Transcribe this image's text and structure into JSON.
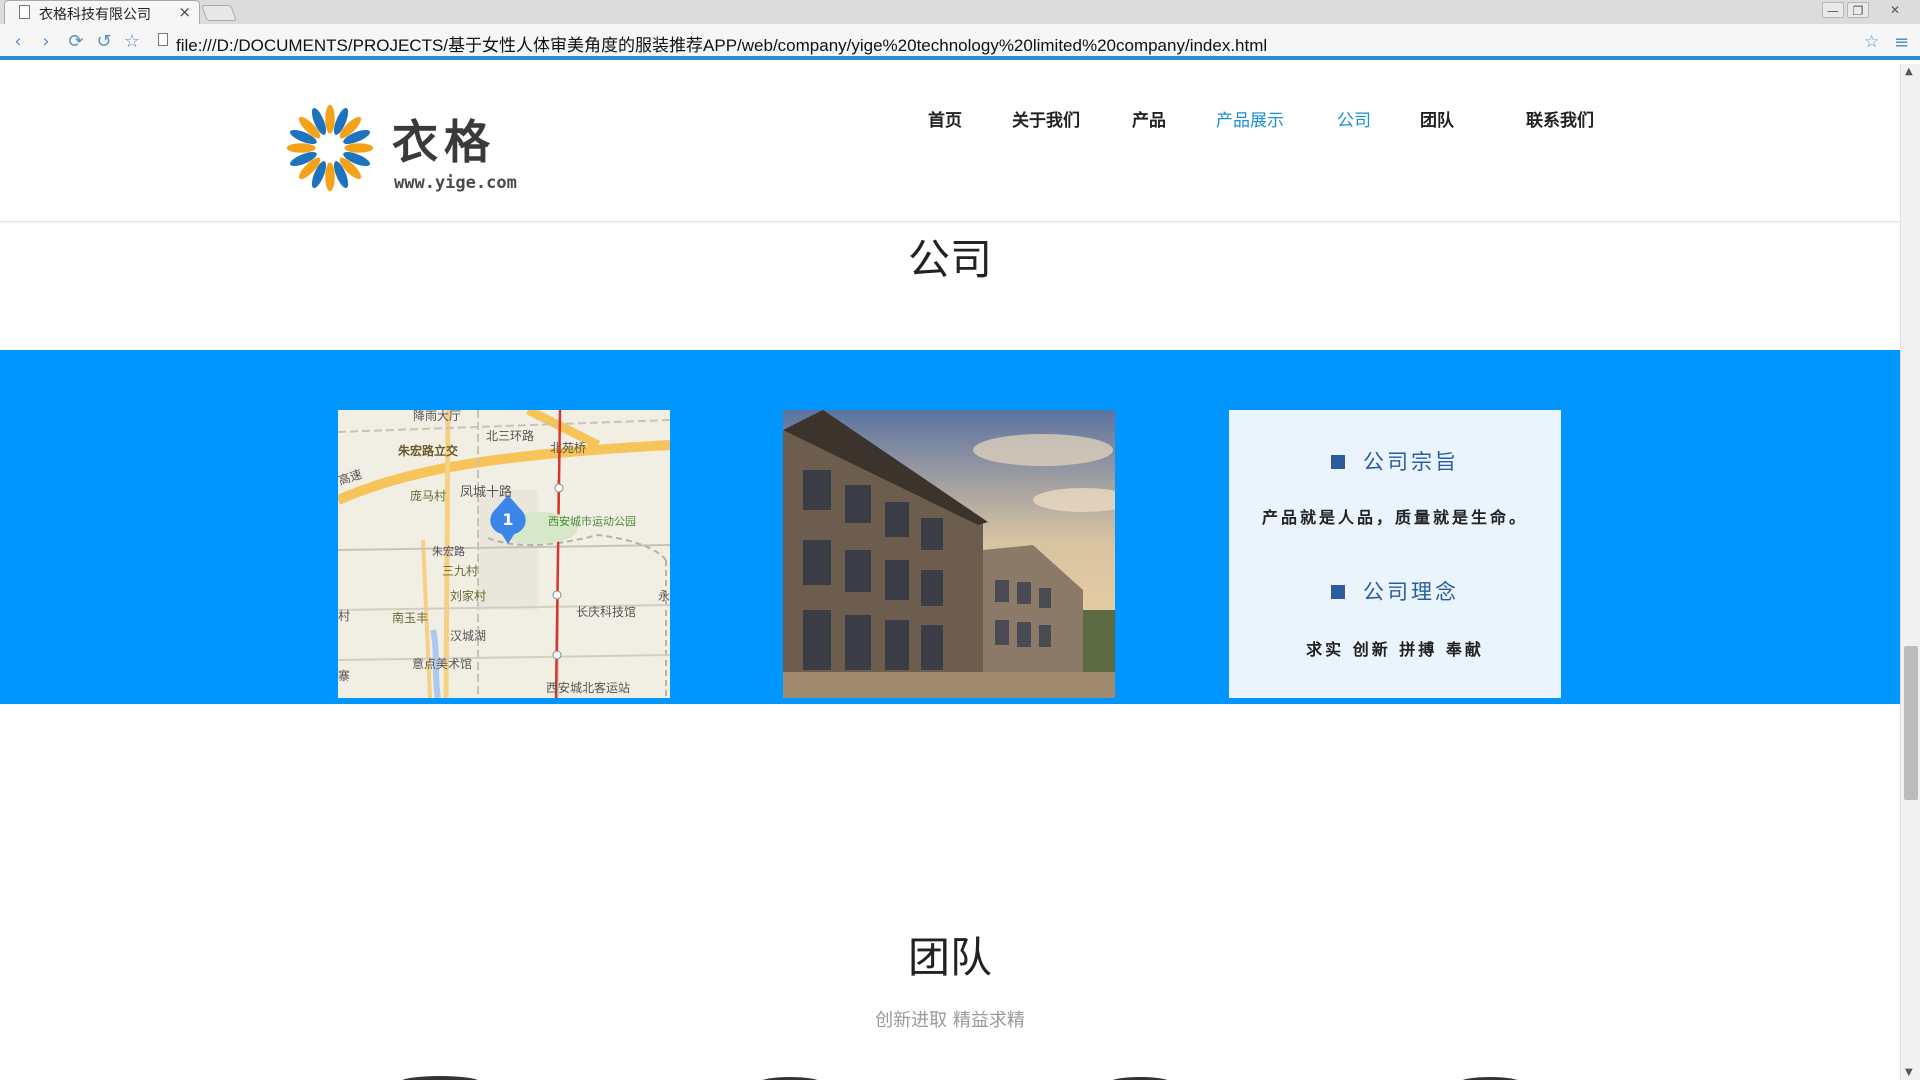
{
  "browser": {
    "tab_title": "衣格科技有限公司",
    "tab_close": "×",
    "url": "file:///D:/DOCUMENTS/PROJECTS/基于女性人体审美角度的服装推荐APP/web/company/yige%20technology%20limited%20company/index.html",
    "window_controls": [
      "—",
      "❐",
      "✕"
    ]
  },
  "header": {
    "logo_name": "衣格",
    "logo_url": "www.yige.com",
    "nav": [
      {
        "label": "首页",
        "active": false
      },
      {
        "label": "关于我们",
        "active": false
      },
      {
        "label": "产品",
        "active": false
      },
      {
        "label": "产品展示",
        "active": true
      },
      {
        "label": "公司",
        "active": true
      },
      {
        "label": "团队",
        "active": false
      },
      {
        "label": "联系我们",
        "active": false
      }
    ]
  },
  "company": {
    "title": "公司",
    "map_labels": [
      "降雨大厅",
      "北三环路",
      "北苑桥",
      "朱宏路立交",
      "高速",
      "庞马村",
      "凤城十路",
      "西安城市运动公园",
      "朱宏路",
      "三九村",
      "刘家村",
      "长庆科技馆",
      "南玉丰",
      "汉城湖",
      "意点美术馆",
      "西安城北客运站",
      "永",
      "村",
      "寨"
    ],
    "map_marker": "1",
    "mission_heading": "公司宗旨",
    "mission_text": "产品就是人品，质量就是生命。",
    "philosophy_heading": "公司理念",
    "philosophy_text": "求实 创新 拼搏 奉献",
    "band_color": "#0095ff"
  },
  "team": {
    "title": "团队",
    "subtitle": "创新进取 精益求精"
  },
  "colors": {
    "accent": "#1a8fd8",
    "logo_orange": "#f5a21b",
    "logo_blue": "#1e73be"
  }
}
